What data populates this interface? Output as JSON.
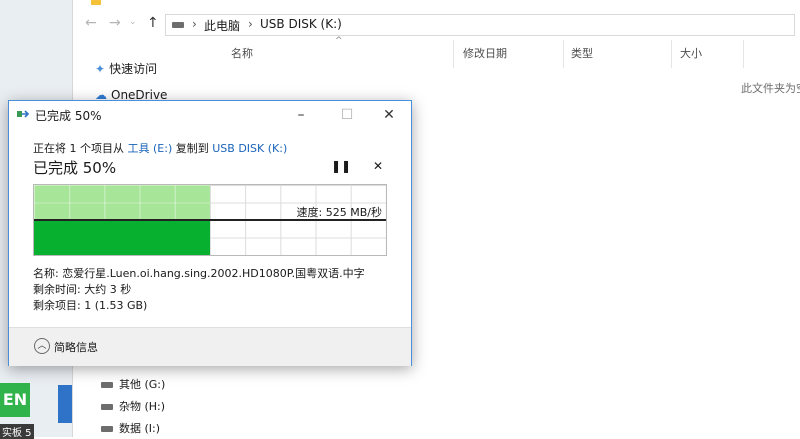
{
  "desktop": {
    "icon_text": "EN",
    "icon_label": "实板 5"
  },
  "explorer": {
    "address": {
      "segment_1": "此电脑",
      "segment_2": "USB DISK (K:)"
    },
    "nav_pane": {
      "quick_access": "快速访问",
      "onedrive": "OneDrive",
      "drives": [
        "其他 (G:)",
        "杂物 (H:)",
        "数据 (I:)"
      ]
    },
    "columns": {
      "name": "名称",
      "modified": "修改日期",
      "type": "类型",
      "size": "大小"
    },
    "empty_message": "此文件夹为空"
  },
  "dialog": {
    "title": "已完成 50%",
    "copy_prefix": "正在将 1 个项目从",
    "source": "工具 (E:)",
    "copy_mid": "复制到",
    "destination": "USB DISK (K:)",
    "progress_label": "已完成 50%",
    "progress_fraction": 0.5,
    "speed": "速度: 525 MB/秒",
    "name_line": "名称: 恋爱行星.Luen.oi.hang.sing.2002.HD1080P.国粤双语.中字",
    "time_left": "剩余时间: 大约 3 秒",
    "items_left": "剩余项目: 1 (1.53 GB)",
    "details_toggle": "简略信息"
  },
  "colors": {
    "progress_light": "#a7e599",
    "progress_dark": "#07b02e",
    "link": "#1a64b8"
  }
}
